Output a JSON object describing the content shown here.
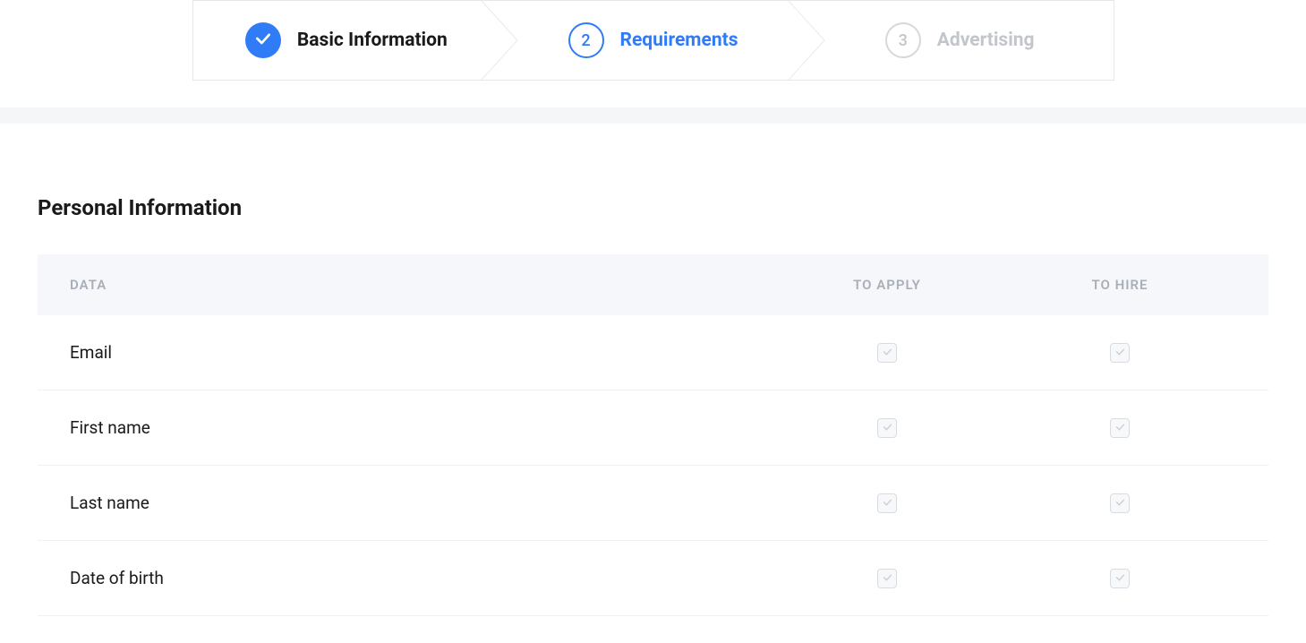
{
  "stepper": {
    "steps": [
      {
        "label": "Basic Information",
        "state": "completed"
      },
      {
        "label": "Requirements",
        "number": "2",
        "state": "active"
      },
      {
        "label": "Advertising",
        "number": "3",
        "state": "inactive"
      }
    ]
  },
  "section": {
    "title": "Personal Information"
  },
  "table": {
    "headers": {
      "data": "DATA",
      "to_apply": "TO APPLY",
      "to_hire": "TO HIRE"
    },
    "rows": [
      {
        "label": "Email",
        "to_apply": true,
        "to_hire": true
      },
      {
        "label": "First name",
        "to_apply": true,
        "to_hire": true
      },
      {
        "label": "Last name",
        "to_apply": true,
        "to_hire": true
      },
      {
        "label": "Date of birth",
        "to_apply": true,
        "to_hire": true
      }
    ]
  },
  "colors": {
    "primary": "#2f7cf6",
    "muted": "#c2c6cc",
    "header_text": "#a9afb8",
    "border": "#e5e7eb"
  }
}
